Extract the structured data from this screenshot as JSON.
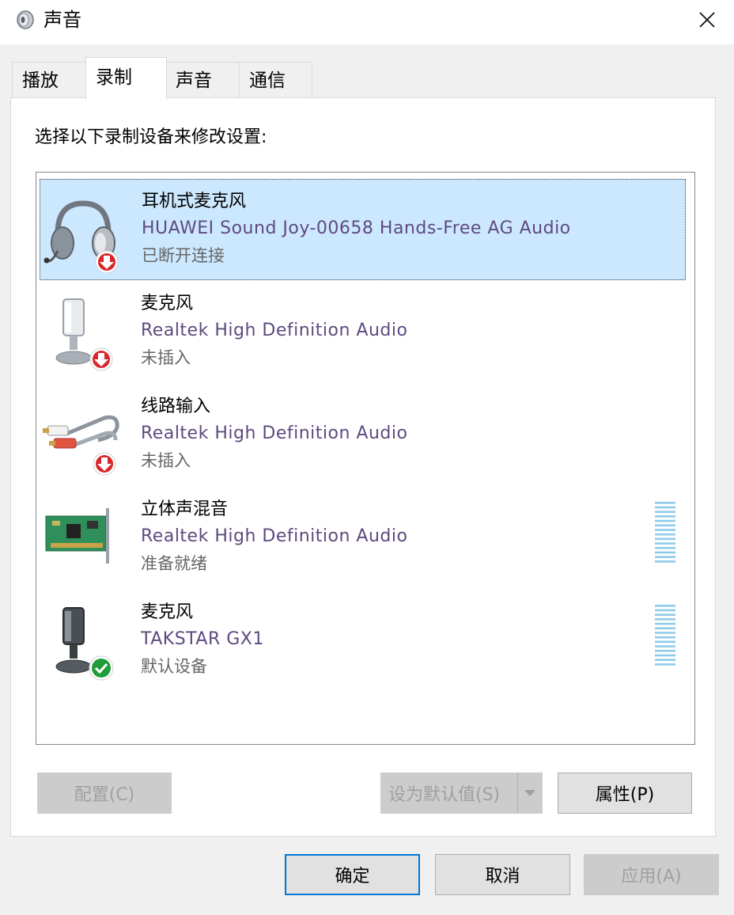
{
  "window": {
    "title": "声音"
  },
  "tabs": [
    {
      "label": "播放"
    },
    {
      "label": "录制"
    },
    {
      "label": "声音"
    },
    {
      "label": "通信"
    }
  ],
  "instruction": "选择以下录制设备来修改设置:",
  "devices": [
    {
      "name": "耳机式麦克风",
      "driver": "HUAWEI Sound Joy-00658 Hands-Free AG Audio",
      "status": "已断开连接",
      "icon": "headset-icon",
      "badge": "disconnected-arrow",
      "selected": true
    },
    {
      "name": "麦克风",
      "driver": "Realtek High Definition Audio",
      "status": "未插入",
      "icon": "microphone-icon",
      "badge": "disconnected-arrow"
    },
    {
      "name": "线路输入",
      "driver": "Realtek High Definition Audio",
      "status": "未插入",
      "icon": "rca-cable-icon",
      "badge": "disconnected-arrow"
    },
    {
      "name": "立体声混音",
      "driver": "Realtek High Definition Audio",
      "status": "准备就绪",
      "icon": "sound-card-icon",
      "level_meter": true
    },
    {
      "name": "麦克风",
      "driver": "TAKSTAR GX1",
      "status": "默认设备",
      "icon": "microphone-icon",
      "badge": "default-check",
      "level_meter": true
    }
  ],
  "buttons": {
    "configure": "配置(C)",
    "set_default": "设为默认值(S)",
    "properties": "属性(P)",
    "ok": "确定",
    "cancel": "取消",
    "apply": "应用(A)"
  },
  "colors": {
    "selection": "#cce8ff",
    "driver_text": "#5e4a7f",
    "default_border": "#0078d7",
    "disconnected_badge": "#d9262c",
    "default_badge": "#1f9d3a"
  }
}
